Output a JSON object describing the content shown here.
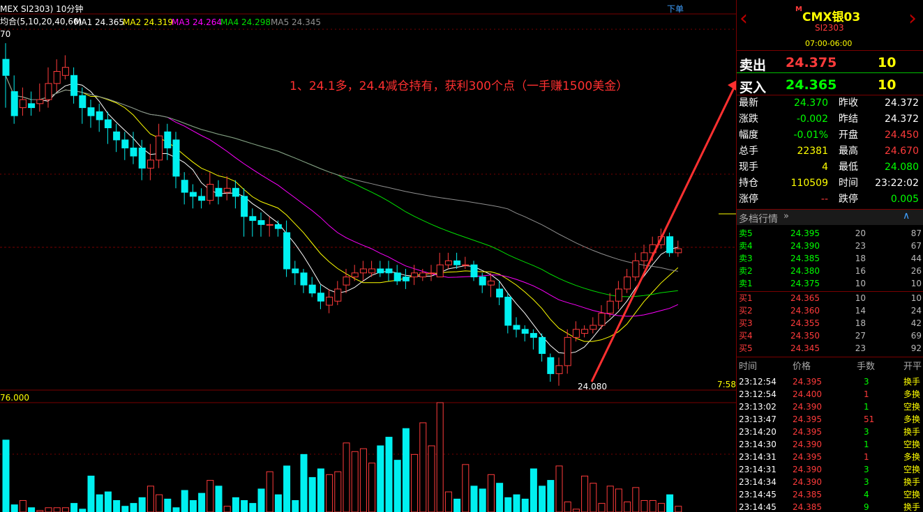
{
  "header": {
    "title": "MEX SI2303) 10分钟",
    "order_link": "下单",
    "ma_label": "均合(5,10,20,40,60)",
    "ma": [
      {
        "label": "MA1 24.365",
        "color": "#ffffff"
      },
      {
        "label": "MA2 24.319",
        "color": "#ffff00"
      },
      {
        "label": "MA3 24.264",
        "color": "#ff00ff"
      },
      {
        "label": "MA4 24.298",
        "color": "#00e000"
      },
      {
        "label": "MA5 24.345",
        "color": "#909090"
      }
    ],
    "axis_top_fragment": "70",
    "low_label": "24.080",
    "time_fragment": "7:58",
    "volume_label": "76.000"
  },
  "annotation": "1、24.1多，24.4减仓持有，获利300个点（一手赚1500美金）",
  "colors": {
    "up": "#ff3b3b",
    "down": "#00f0f0",
    "grid": "#7a0000",
    "yellow": "#ffff00",
    "green": "#00ff00"
  },
  "candles": [
    [
      24.74,
      24.7,
      24.78,
      24.62
    ],
    [
      24.66,
      24.6,
      24.7,
      24.58
    ],
    [
      24.62,
      24.64,
      24.67,
      24.6
    ],
    [
      24.63,
      24.62,
      24.66,
      24.6
    ],
    [
      24.63,
      24.64,
      24.68,
      24.61
    ],
    [
      24.64,
      24.68,
      24.72,
      24.62
    ],
    [
      24.68,
      24.71,
      24.74,
      24.66
    ],
    [
      24.7,
      24.72,
      24.75,
      24.69
    ],
    [
      24.7,
      24.65,
      24.72,
      24.63
    ],
    [
      24.65,
      24.62,
      24.67,
      24.58
    ],
    [
      24.62,
      24.6,
      24.64,
      24.57
    ],
    [
      24.61,
      24.59,
      24.63,
      24.56
    ],
    [
      24.59,
      24.57,
      24.61,
      24.53
    ],
    [
      24.56,
      24.54,
      24.58,
      24.51
    ],
    [
      24.54,
      24.52,
      24.56,
      24.49
    ],
    [
      24.52,
      24.5,
      24.56,
      24.48
    ],
    [
      24.52,
      24.47,
      24.54,
      24.44
    ],
    [
      24.47,
      24.49,
      24.53,
      24.44
    ],
    [
      24.49,
      24.55,
      24.58,
      24.47
    ],
    [
      24.56,
      24.52,
      24.58,
      24.49
    ],
    [
      24.54,
      24.45,
      24.56,
      24.42
    ],
    [
      24.44,
      24.41,
      24.46,
      24.38
    ],
    [
      24.41,
      24.4,
      24.43,
      24.37
    ],
    [
      24.4,
      24.39,
      24.42,
      24.37
    ],
    [
      24.39,
      24.43,
      24.46,
      24.38
    ],
    [
      24.42,
      24.4,
      24.44,
      24.38
    ],
    [
      24.41,
      24.42,
      24.45,
      24.39
    ],
    [
      24.42,
      24.4,
      24.44,
      24.37
    ],
    [
      24.4,
      24.35,
      24.42,
      24.3
    ],
    [
      24.35,
      24.34,
      24.37,
      24.3
    ],
    [
      24.34,
      24.33,
      24.36,
      24.3
    ],
    [
      24.33,
      24.33,
      24.35,
      24.3
    ],
    [
      24.33,
      24.32,
      24.34,
      24.3
    ],
    [
      24.31,
      24.22,
      24.34,
      24.2
    ],
    [
      24.22,
      24.21,
      24.24,
      24.18
    ],
    [
      24.21,
      24.18,
      24.22,
      24.16
    ],
    [
      24.18,
      24.16,
      24.2,
      24.15
    ],
    [
      24.16,
      24.14,
      24.18,
      24.12
    ],
    [
      24.13,
      24.15,
      24.17,
      24.11
    ],
    [
      24.14,
      24.17,
      24.19,
      24.13
    ],
    [
      24.18,
      24.2,
      24.22,
      24.16
    ],
    [
      24.2,
      24.21,
      24.23,
      24.19
    ],
    [
      24.21,
      24.22,
      24.24,
      24.19
    ],
    [
      24.21,
      24.22,
      24.24,
      24.2
    ],
    [
      24.22,
      24.21,
      24.24,
      24.2
    ],
    [
      24.22,
      24.21,
      24.24,
      24.19
    ],
    [
      24.21,
      24.19,
      24.23,
      24.18
    ],
    [
      24.2,
      24.19,
      24.22,
      24.17
    ],
    [
      24.2,
      24.21,
      24.23,
      24.18
    ],
    [
      24.2,
      24.21,
      24.22,
      24.19
    ],
    [
      24.21,
      24.21,
      24.23,
      24.19
    ],
    [
      24.2,
      24.23,
      24.26,
      24.2
    ],
    [
      24.23,
      24.24,
      24.26,
      24.22
    ],
    [
      24.24,
      24.23,
      24.26,
      24.22
    ],
    [
      24.23,
      24.23,
      24.25,
      24.22
    ],
    [
      24.23,
      24.2,
      24.24,
      24.19
    ],
    [
      24.2,
      24.18,
      24.21,
      24.16
    ],
    [
      24.18,
      24.19,
      24.21,
      24.15
    ],
    [
      24.17,
      24.15,
      24.19,
      24.13
    ],
    [
      24.15,
      24.08,
      24.16,
      24.06
    ],
    [
      24.08,
      24.07,
      24.1,
      24.05
    ],
    [
      24.07,
      24.06,
      24.08,
      24.04
    ],
    [
      24.06,
      24.05,
      24.07,
      24.02
    ],
    [
      24.05,
      24.01,
      24.06,
      23.99
    ],
    [
      24.0,
      23.96,
      24.01,
      23.94
    ],
    [
      23.96,
      23.98,
      24.0,
      23.93
    ],
    [
      23.98,
      24.05,
      24.07,
      23.96
    ],
    [
      24.05,
      24.07,
      24.09,
      24.04
    ],
    [
      24.06,
      24.07,
      24.08,
      24.05
    ],
    [
      24.07,
      24.08,
      24.1,
      24.06
    ],
    [
      24.08,
      24.11,
      24.13,
      24.07
    ],
    [
      24.11,
      24.14,
      24.16,
      24.1
    ],
    [
      24.14,
      24.17,
      24.19,
      24.12
    ],
    [
      24.17,
      24.2,
      24.22,
      24.16
    ],
    [
      24.2,
      24.24,
      24.26,
      24.19
    ],
    [
      24.24,
      24.26,
      24.28,
      24.22
    ],
    [
      24.26,
      24.28,
      24.3,
      24.24
    ],
    [
      24.28,
      24.3,
      24.32,
      24.27
    ],
    [
      24.3,
      24.26,
      24.31,
      24.25
    ],
    [
      24.26,
      24.27,
      24.29,
      24.25
    ]
  ],
  "volumes": [
    50,
    5,
    8,
    3,
    1,
    3,
    3,
    3,
    6,
    2,
    25,
    12,
    14,
    8,
    4,
    6,
    10,
    18,
    12,
    9,
    3,
    15,
    8,
    13,
    22,
    18,
    4,
    10,
    8,
    6,
    16,
    28,
    12,
    32,
    8,
    40,
    24,
    30,
    26,
    28,
    48,
    42,
    44,
    34,
    46,
    52,
    36,
    58,
    40,
    62,
    46,
    80,
    14,
    9,
    33,
    18,
    16,
    26,
    20,
    10,
    12,
    9,
    30,
    18,
    22,
    32,
    7,
    2,
    25,
    20,
    6,
    18,
    16,
    7,
    17,
    8,
    8,
    6,
    12,
    4
  ],
  "panel": {
    "symbol_badge": "M",
    "symbol": "CMX银03",
    "code": "SI2303",
    "hours": "07:00-06:00",
    "sell": {
      "label": "卖出",
      "price": "24.375",
      "qty": "10"
    },
    "buy": {
      "label": "买入",
      "price": "24.365",
      "qty": "10"
    },
    "stats": [
      {
        "l1": "最新",
        "v1": "24.370",
        "c1": "#00ff00",
        "l2": "昨收",
        "v2": "24.372",
        "c2": "#ffffff"
      },
      {
        "l1": "涨跌",
        "v1": "-0.002",
        "c1": "#00ff00",
        "l2": "昨结",
        "v2": "24.372",
        "c2": "#ffffff"
      },
      {
        "l1": "幅度",
        "v1": "-0.01%",
        "c1": "#00ff00",
        "l2": "开盘",
        "v2": "24.450",
        "c2": "#ff3b3b"
      },
      {
        "l1": "总手",
        "v1": "22381",
        "c1": "#ffff00",
        "l2": "最高",
        "v2": "24.670",
        "c2": "#ff3b3b"
      },
      {
        "l1": "现手",
        "v1": "4",
        "c1": "#ffff00",
        "l2": "最低",
        "v2": "24.080",
        "c2": "#00ff00"
      },
      {
        "l1": "持仓",
        "v1": "110509",
        "c1": "#ffff00",
        "l2": "时间",
        "v2": "23:22:02",
        "c2": "#ffffff"
      },
      {
        "l1": "涨停",
        "v1": "--",
        "c1": "#ff3b3b",
        "l2": "跌停",
        "v2": "0.005",
        "c2": "#00ff00"
      }
    ],
    "depth_title": "多档行情",
    "asks": [
      {
        "label": "卖5",
        "price": "24.395",
        "qty": "20",
        "extra": "87"
      },
      {
        "label": "卖4",
        "price": "24.390",
        "qty": "23",
        "extra": "67"
      },
      {
        "label": "卖3",
        "price": "24.385",
        "qty": "18",
        "extra": "44"
      },
      {
        "label": "卖2",
        "price": "24.380",
        "qty": "16",
        "extra": "26"
      },
      {
        "label": "卖1",
        "price": "24.375",
        "qty": "10",
        "extra": "10"
      }
    ],
    "bids": [
      {
        "label": "买1",
        "price": "24.365",
        "qty": "10",
        "extra": "10"
      },
      {
        "label": "买2",
        "price": "24.360",
        "qty": "14",
        "extra": "24"
      },
      {
        "label": "买3",
        "price": "24.355",
        "qty": "18",
        "extra": "42"
      },
      {
        "label": "买4",
        "price": "24.350",
        "qty": "27",
        "extra": "69"
      },
      {
        "label": "买5",
        "price": "24.345",
        "qty": "23",
        "extra": "92"
      }
    ],
    "ticks_header": [
      "时间",
      "价格",
      "手数",
      "开平"
    ],
    "ticks": [
      {
        "time": "23:12:54",
        "price": "24.395",
        "qty": "3",
        "type": "换手",
        "qc": "#00ff00"
      },
      {
        "time": "23:12:54",
        "price": "24.400",
        "qty": "1",
        "type": "多换",
        "qc": "#ff3b3b"
      },
      {
        "time": "23:13:02",
        "price": "24.390",
        "qty": "1",
        "type": "空换",
        "qc": "#00ff00"
      },
      {
        "time": "23:13:47",
        "price": "24.395",
        "qty": "51",
        "type": "多换",
        "qc": "#ff3b3b"
      },
      {
        "time": "23:14:20",
        "price": "24.395",
        "qty": "3",
        "type": "换手",
        "qc": "#00ff00"
      },
      {
        "time": "23:14:30",
        "price": "24.390",
        "qty": "1",
        "type": "空换",
        "qc": "#00ff00"
      },
      {
        "time": "23:14:31",
        "price": "24.395",
        "qty": "1",
        "type": "多换",
        "qc": "#ff3b3b"
      },
      {
        "time": "23:14:31",
        "price": "24.390",
        "qty": "3",
        "type": "空换",
        "qc": "#00ff00"
      },
      {
        "time": "23:14:34",
        "price": "24.390",
        "qty": "3",
        "type": "换手",
        "qc": "#00ff00"
      },
      {
        "time": "23:14:45",
        "price": "24.385",
        "qty": "4",
        "type": "空换",
        "qc": "#00ff00"
      },
      {
        "time": "23:14:45",
        "price": "24.385",
        "qty": "9",
        "type": "换手",
        "qc": "#00ff00"
      }
    ]
  }
}
